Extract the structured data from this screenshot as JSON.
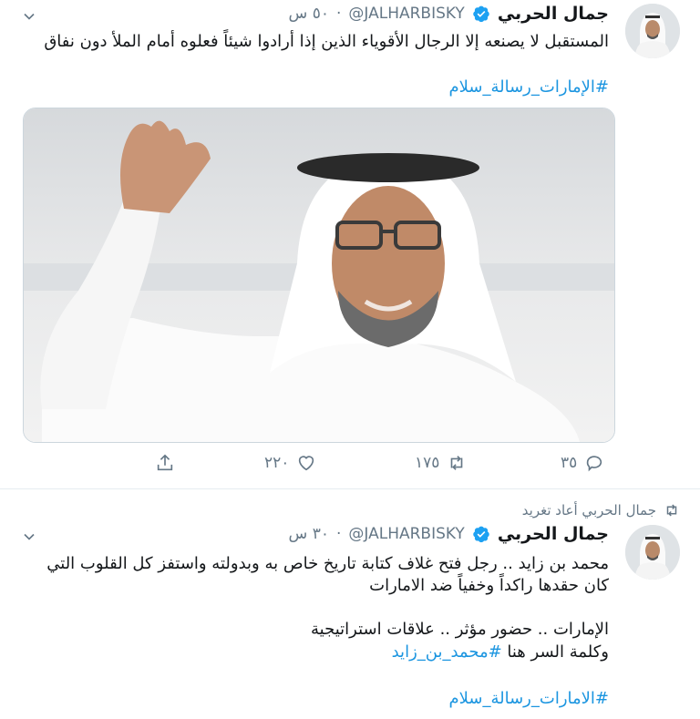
{
  "tweet1": {
    "name": "جمال الحربي",
    "handle": "@JALHARBISKY",
    "time": "٥٠ س",
    "text": "المستقبل لا يصنعه إلا الرجال الأقوياء الذين إذا أرادوا شيئاً فعلوه أمام الملأ دون نفاق",
    "hashtag": "#الإمارات_رسالة_سلام",
    "actions": {
      "reply_count": "٣٥",
      "retweet_count": "١٧٥",
      "like_count": "٢٢٠"
    }
  },
  "tweet2": {
    "retweet_context": "جمال الحربي أعاد تغريد",
    "name": "جمال الحربي",
    "handle": "@JALHARBISKY",
    "time": "٣٠ س",
    "line1": "محمد بن زايد .. رجل فتح غلاف كتابة تاريخ خاص به وبدولته واستفز كل القلوب التي",
    "line2": "كان حقدها راكداً وخفياً ضد الامارات",
    "line3": "الإمارات .. حضور مؤثر .. علاقات استراتيجية",
    "line4_prefix": "وكلمة السر هنا ",
    "line4_hashtag": "#محمد_بن_زايد",
    "hashtag": "#الامارات_رسالة_سلام"
  },
  "colors": {
    "link": "#1b95e0",
    "verified": "#1da1f2",
    "muted": "#657786"
  }
}
